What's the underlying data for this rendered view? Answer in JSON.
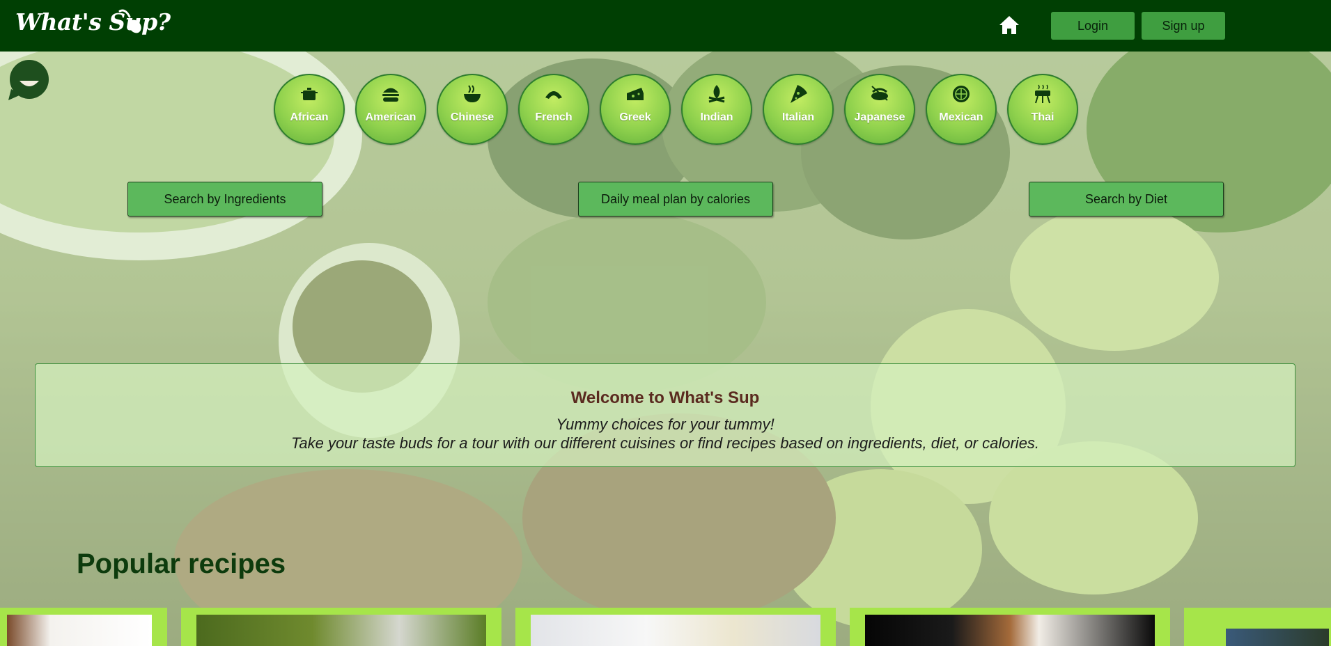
{
  "header": {
    "logo_text": "What's Sup?",
    "login_label": "Login",
    "signup_label": "Sign up"
  },
  "cuisines": [
    {
      "label": "African",
      "icon": "pot-icon"
    },
    {
      "label": "American",
      "icon": "burger-icon"
    },
    {
      "label": "Chinese",
      "icon": "noodle-bowl-icon"
    },
    {
      "label": "French",
      "icon": "croissant-icon"
    },
    {
      "label": "Greek",
      "icon": "cheese-icon"
    },
    {
      "label": "Indian",
      "icon": "campfire-icon"
    },
    {
      "label": "Italian",
      "icon": "pizza-icon"
    },
    {
      "label": "Japanese",
      "icon": "sushi-icon"
    },
    {
      "label": "Mexican",
      "icon": "lime-icon"
    },
    {
      "label": "Thai",
      "icon": "grill-icon"
    }
  ],
  "search": {
    "ingredients_label": "Search by Ingredients",
    "calories_label": "Daily meal plan by calories",
    "diet_label": "Search by Diet"
  },
  "welcome": {
    "title": "Welcome to What's Sup",
    "line1": "Yummy choices for your tummy!",
    "line2": "Take your taste buds for a tour with our different cuisines or find recipes based on ingredients, diet, or calories."
  },
  "popular": {
    "title": "Popular recipes"
  },
  "colors": {
    "header_bg": "#003f03",
    "button_green": "#5cb85c",
    "card_green": "#a6e54a",
    "title_brown": "#5a2a1f",
    "popular_green": "#0d3b0d"
  }
}
